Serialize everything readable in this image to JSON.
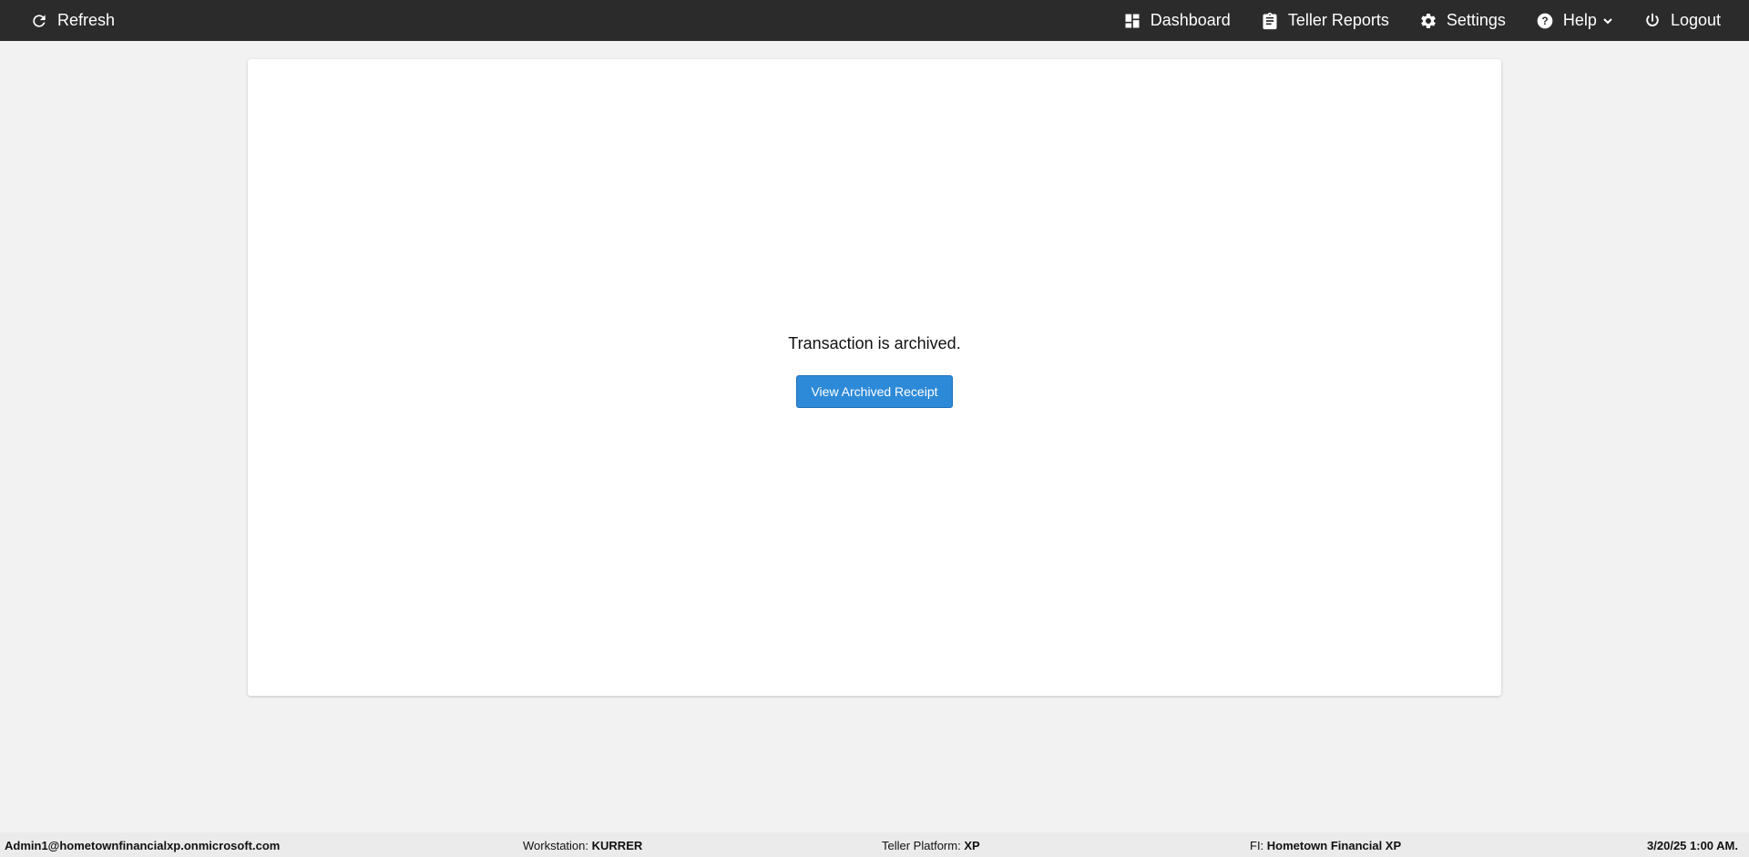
{
  "header": {
    "refresh_label": "Refresh",
    "dashboard_label": "Dashboard",
    "teller_reports_label": "Teller Reports",
    "settings_label": "Settings",
    "help_label": "Help",
    "logout_label": "Logout"
  },
  "main": {
    "message": "Transaction is archived.",
    "button_label": "View Archived Receipt"
  },
  "footer": {
    "user": "Admin1@hometownfinancialxp.onmicrosoft.com",
    "workstation_label": "Workstation:",
    "workstation_value": "KURRER",
    "platform_label": "Teller Platform:",
    "platform_value": "XP",
    "fi_label": "FI:",
    "fi_value": "Hometown Financial XP",
    "datetime": "3/20/25 1:00 AM."
  },
  "icons": {
    "refresh": "refresh-icon",
    "dashboard": "dashboard-icon",
    "reports": "clipboard-icon",
    "settings": "gear-icon",
    "help": "help-circle-icon",
    "logout": "power-icon"
  },
  "colors": {
    "topbar": "#2b2b2b",
    "button": "#2d8ad8",
    "background": "#f2f2f2"
  }
}
